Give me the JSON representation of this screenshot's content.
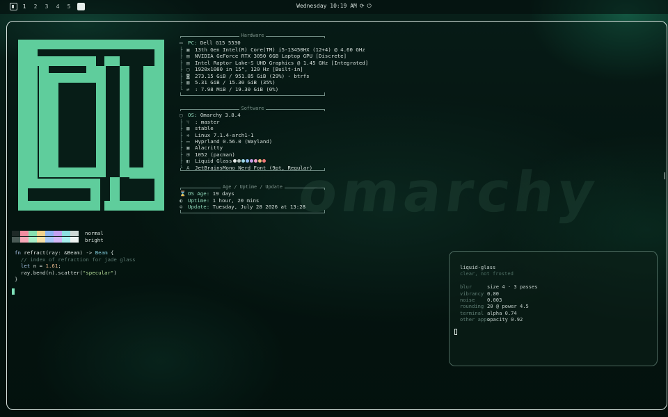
{
  "topbar": {
    "workspaces": [
      "1",
      "2",
      "3",
      "4",
      "5"
    ],
    "clock": "Wednesday 10:19 AM",
    "tray_icons": [
      "refresh-icon",
      "power-icon"
    ]
  },
  "watermark": "omarchy",
  "fastfetch": {
    "hardware_title": "Hardware",
    "hardware": [
      {
        "icon": "laptop-icon",
        "key": "PC:",
        "value": "Dell G15 5530"
      },
      {
        "icon": "cpu-icon",
        "tree": "├",
        "value": "13th Gen Intel(R) Core(TM) i5-13450HX (12+4) @ 4.60 GHz"
      },
      {
        "icon": "gpu-icon",
        "tree": "├",
        "value": "NVIDIA GeForce RTX 3050 6GB Laptop GPU [Discrete]"
      },
      {
        "icon": "gpu-icon",
        "tree": "├",
        "value": "Intel Raptor Lake-S UHD Graphics @ 1.45 GHz [Integrated]"
      },
      {
        "icon": "display-icon",
        "tree": "├",
        "value": "1920x1080 in 15\", 120 Hz [Built-in]"
      },
      {
        "icon": "disk-icon",
        "tree": "├",
        "value": "273.15 GiB / 951.85 GiB (29%) - btrfs"
      },
      {
        "icon": "memory-icon",
        "tree": "├",
        "value": "5.31 GiB / 15.30 GiB (35%)"
      },
      {
        "icon": "swap-icon",
        "tree": "└",
        "value": ": 7.98 MiB / 19.30 GiB (0%)"
      }
    ],
    "software_title": "Software",
    "software": [
      {
        "icon": "os-icon",
        "key": "OS:",
        "value": "Omarchy 3.8.4"
      },
      {
        "icon": "branch-icon",
        "tree": "├",
        "value": ": master"
      },
      {
        "icon": "channel-icon",
        "tree": "├",
        "value": "stable"
      },
      {
        "icon": "kernel-icon",
        "tree": "├",
        "value": "Linux 7.1.4-arch1-1"
      },
      {
        "icon": "wm-icon",
        "tree": "├",
        "value": "Hyprland 0.56.0 (Wayland)"
      },
      {
        "icon": "terminal-icon",
        "tree": "├",
        "value": "Alacritty"
      },
      {
        "icon": "package-icon",
        "tree": "├",
        "value": "1052 (pacman)"
      },
      {
        "icon": "theme-icon",
        "tree": "├",
        "value": "Liquid Glass"
      },
      {
        "icon": "font-icon",
        "tree": "└",
        "value": "JetBrainsMono Nerd Font (9pt, Regular)"
      }
    ],
    "theme_dots": [
      "#e8ecea",
      "#b8c4c1",
      "#9fd9e8",
      "#8fb8f0",
      "#c8a0e8",
      "#f0a0c8",
      "#f0c080",
      "#f07878"
    ],
    "age_title": "Age / Uptime / Update",
    "age": [
      {
        "icon": "hourglass-icon",
        "key": "OS Age:",
        "value": "19 days"
      },
      {
        "icon": "uptime-icon",
        "key": "Uptime:",
        "value": "1 hour, 20 mins"
      },
      {
        "icon": "update-icon",
        "key": "Update:",
        "value": "Tuesday, July 28 2026 at 13:28"
      }
    ]
  },
  "palette": {
    "normal_label": "normal",
    "bright_label": "bright",
    "normal": [
      "#1f2a27",
      "#f28ca0",
      "#86e0b0",
      "#f2d28c",
      "#8cb4f2",
      "#c4a0f0",
      "#8ce0e0",
      "#cfd8d5"
    ],
    "bright": [
      "#4a5a55",
      "#f7a8b8",
      "#a8efc8",
      "#f7e0a8",
      "#a8c8f7",
      "#d4b8f7",
      "#a8efef",
      "#eef3f1"
    ]
  },
  "code": {
    "line1_kw": "fn",
    "line1_name": " refract",
    "line1_args": "(ray: &Beam) -> ",
    "line1_type": "Beam",
    "line1_tail": " {",
    "line2": "  // index of refraction for jade glass",
    "line3_kw": "  let",
    "line3_mid": " n = ",
    "line3_num": "1.61",
    "line3_tail": ";",
    "line4_a": "  ray.bend(n).scatter(",
    "line4_str": "\"specular\"",
    "line4_b": ")",
    "line5": "}"
  },
  "panel": {
    "title": "liquid-glass",
    "subtitle": "clear, not frosted",
    "settings": [
      {
        "key": "blur",
        "value": "size 4 · 3 passes"
      },
      {
        "key": "vibrancy",
        "value": "0.80"
      },
      {
        "key": "noise",
        "value": "0.003"
      },
      {
        "key": "rounding",
        "value": "20 @ power 4.5"
      },
      {
        "key": "terminal",
        "value": "alpha 0.74"
      },
      {
        "key": "other apps",
        "value": "opacity 0.92"
      }
    ]
  }
}
